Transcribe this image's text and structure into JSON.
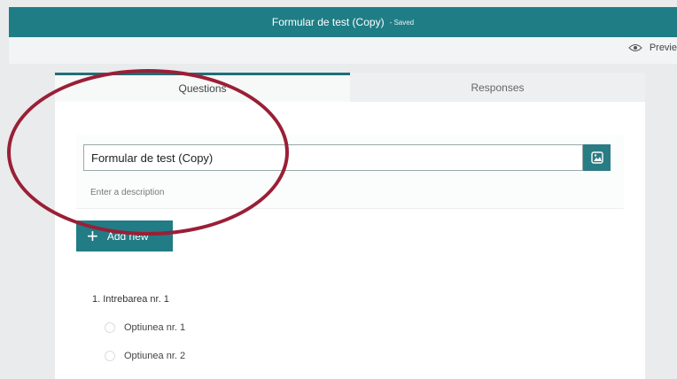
{
  "header": {
    "title": "Formular de test (Copy)",
    "status": "- Saved"
  },
  "toolbar": {
    "preview_label": "Previe",
    "preview_icon": "eye-icon"
  },
  "tabs": [
    {
      "label": "Questions",
      "active": true
    },
    {
      "label": "Responses",
      "active": false
    }
  ],
  "form": {
    "title_value": "Formular de test (Copy)",
    "description_placeholder": "Enter a description",
    "image_icon": "image-icon"
  },
  "add_new": {
    "label": "Add new",
    "icon": "plus-icon"
  },
  "question": {
    "text": "1. Intrebarea nr. 1",
    "options": [
      "Optiunea nr. 1",
      "Optiunea nr. 2"
    ]
  },
  "colors": {
    "accent": "#1f7d86",
    "annotation": "#9a1f36"
  }
}
